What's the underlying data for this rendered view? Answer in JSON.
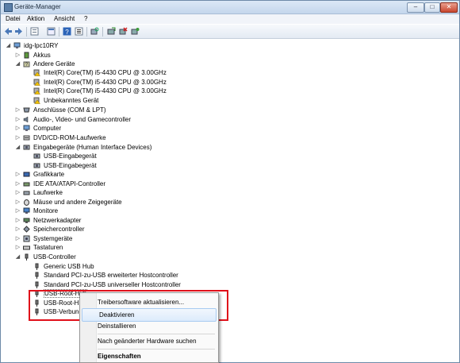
{
  "window": {
    "title": "Geräte-Manager"
  },
  "menubar": {
    "items": [
      "Datei",
      "Aktion",
      "Ansicht",
      "?"
    ]
  },
  "tree": {
    "root": "idg-lpc10RY",
    "nodes": [
      {
        "label": "Akkus"
      },
      {
        "label": "Andere Geräte"
      },
      {
        "label": "Intel(R) Core(TM) i5-4430 CPU @ 3.00GHz"
      },
      {
        "label": "Intel(R) Core(TM) i5-4430 CPU @ 3.00GHz"
      },
      {
        "label": "Intel(R) Core(TM) i5-4430 CPU @ 3.00GHz"
      },
      {
        "label": "Unbekanntes Gerät"
      },
      {
        "label": "Anschlüsse (COM & LPT)"
      },
      {
        "label": "Audio-, Video- und Gamecontroller"
      },
      {
        "label": "Computer"
      },
      {
        "label": "DVD/CD-ROM-Laufwerke"
      },
      {
        "label": "Eingabegeräte (Human Interface Devices)"
      },
      {
        "label": "USB-Eingabegerät"
      },
      {
        "label": "USB-Eingabegerät"
      },
      {
        "label": "Grafikkarte"
      },
      {
        "label": "IDE ATA/ATAPI-Controller"
      },
      {
        "label": "Laufwerke"
      },
      {
        "label": "Mäuse und andere Zeigegeräte"
      },
      {
        "label": "Monitore"
      },
      {
        "label": "Netzwerkadapter"
      },
      {
        "label": "Speichercontroller"
      },
      {
        "label": "Systemgeräte"
      },
      {
        "label": "Tastaturen"
      },
      {
        "label": "USB-Controller"
      },
      {
        "label": "Generic USB Hub"
      },
      {
        "label": "Standard PCI-zu-USB erweiterter Hostcontroller"
      },
      {
        "label": "Standard PCI-zu-USB universeller Hostcontroller"
      },
      {
        "label": "USB-Root-Hub"
      },
      {
        "label": "USB-Root-Hu"
      },
      {
        "label": "USB-Verbund"
      }
    ]
  },
  "context_menu": {
    "items": [
      {
        "label": "Treibersoftware aktualisieren..."
      },
      {
        "label": "Deaktivieren"
      },
      {
        "label": "Deinstallieren"
      },
      {
        "label": "Nach geänderter Hardware suchen"
      },
      {
        "label": "Eigenschaften"
      }
    ]
  },
  "colors": {
    "highlight_box": "#e0101a",
    "titlebar": "#c4d6ec",
    "selection": "#dcebfc"
  }
}
